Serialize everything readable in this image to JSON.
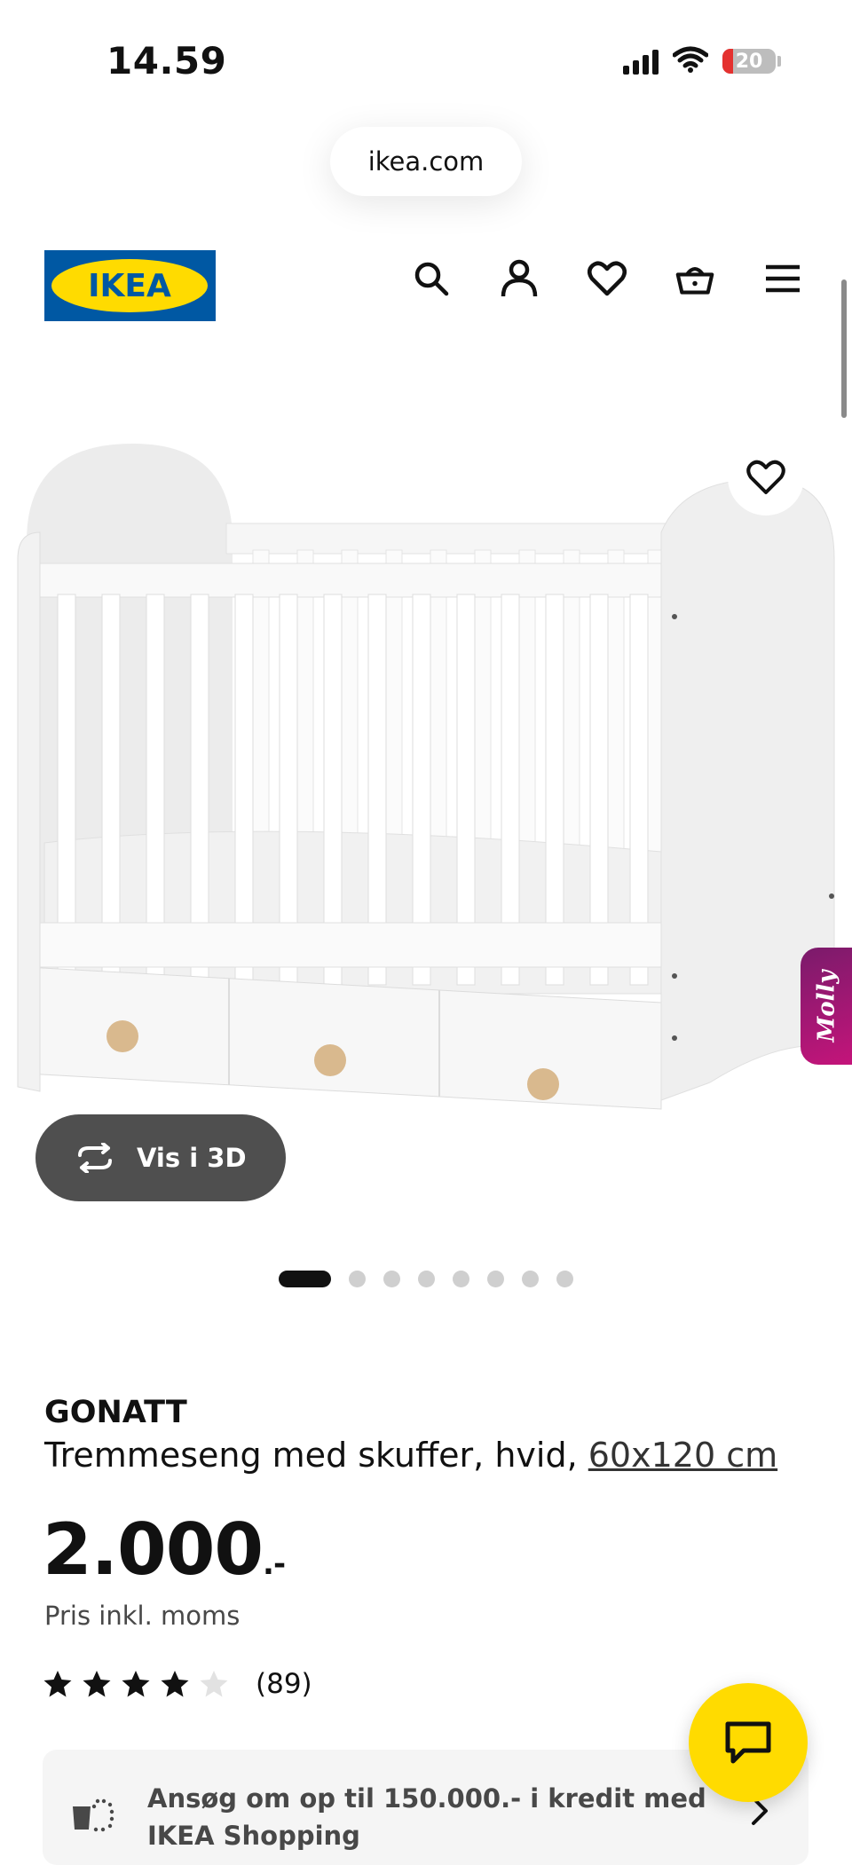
{
  "status_bar": {
    "time": "14.59",
    "battery": "20",
    "battery_level": 0.2
  },
  "browser": {
    "url": "ikea.com"
  },
  "header": {
    "logo_text": "IKEA",
    "icons": [
      "search-icon",
      "user-icon",
      "heart-icon",
      "basket-icon",
      "menu-icon"
    ]
  },
  "product": {
    "brand": "GONATT",
    "description": "Tremmeseng med skuffer, hvid,",
    "size": "60x120 cm",
    "price": "2.000",
    "price_suffix": ".-",
    "vat_note": "Pris inkl. moms",
    "rating": 4,
    "rating_max": 5,
    "reviews_count": "(89)",
    "view_3d_label": "Vis i 3D",
    "gallery_total": 8,
    "gallery_active": 1
  },
  "molly": {
    "label": "Molly"
  },
  "credit": {
    "text": "Ansøg om op til 150.000.- i kredit med IKEA Shopping"
  },
  "colors": {
    "ikea_blue": "#0058a3",
    "ikea_yellow": "#ffdb00",
    "molly": "#a0176f"
  }
}
